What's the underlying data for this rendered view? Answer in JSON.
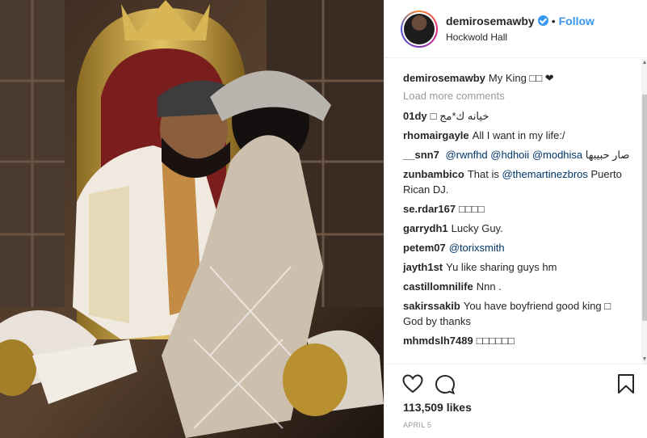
{
  "post": {
    "username": "demirosemawby",
    "follow_label": "Follow",
    "separator": "•",
    "location": "Hockwold Hall",
    "colors": {
      "link": "#3897f0",
      "mention": "#003569",
      "muted": "#999999"
    }
  },
  "caption": {
    "username": "demirosemawby",
    "text": "My King □□ ❤"
  },
  "load_more": "Load more comments",
  "comments": [
    {
      "username": "01dy",
      "text": "خيانه ك*مج □"
    },
    {
      "username": "rhomairgayle",
      "text": "All I want in my life:/"
    },
    {
      "username": "__snn7",
      "mentions": [
        "@rwnfhd",
        "@hdhoii",
        "@modhisa"
      ],
      "text": "صار حبيبها"
    },
    {
      "username": "zunbambico",
      "text_before": "That is",
      "mentions": [
        "@themartinezbros"
      ],
      "text_after": "Puerto Rican DJ."
    },
    {
      "username": "se.rdar167",
      "text": "□□□□"
    },
    {
      "username": "garrydh1",
      "text": "Lucky Guy."
    },
    {
      "username": "petem07",
      "mentions": [
        "@torixsmith"
      ]
    },
    {
      "username": "jayth1st",
      "text": "Yu like sharing guys hm"
    },
    {
      "username": "castillomnilife",
      "text": "Nnn ."
    },
    {
      "username": "sakirssakib",
      "text": "You have boyfriend good king □ God by thanks"
    },
    {
      "username": "mhmdslh7489",
      "text": "□□□□□□"
    }
  ],
  "likes": "113,509 likes",
  "date": "APRIL 5",
  "icons": [
    "heart-icon",
    "comment-icon",
    "bookmark-icon",
    "verified-badge-icon"
  ]
}
